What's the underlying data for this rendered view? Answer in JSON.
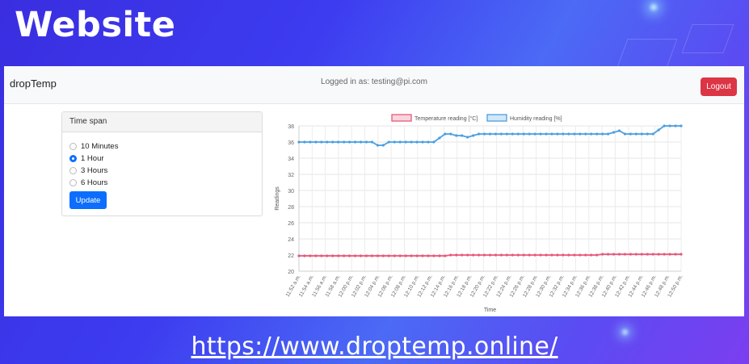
{
  "slide": {
    "title": "Website",
    "url": "https://www.droptemp.online/"
  },
  "navbar": {
    "brand": "dropTemp",
    "logged_in": "Logged in as: testing@pi.com",
    "logout_label": "Logout"
  },
  "time_span": {
    "header": "Time span",
    "options": [
      "10 Minutes",
      "1 Hour",
      "3 Hours",
      "6 Hours"
    ],
    "selected": "1 Hour",
    "update_label": "Update"
  },
  "colors": {
    "temperature": "#e8577b",
    "humidity": "#4a9fe0",
    "logout": "#dc3545",
    "primary": "#0d6efd"
  },
  "chart_data": {
    "type": "line",
    "xlabel": "Time",
    "ylabel": "Readings",
    "ylim": [
      20,
      38
    ],
    "yticks": [
      20,
      22,
      24,
      26,
      28,
      30,
      32,
      34,
      36,
      38
    ],
    "x_tick_labels": [
      "11:52 a.m.",
      "11:54 a.m.",
      "11:56 a.m.",
      "11:58 a.m.",
      "12:00 p.m.",
      "12:02 p.m.",
      "12:04 p.m.",
      "12:06 p.m.",
      "12:08 p.m.",
      "12:10 p.m.",
      "12:12 p.m.",
      "12:14 p.m.",
      "12:16 p.m.",
      "12:18 p.m.",
      "12:20 p.m.",
      "12:22 p.m.",
      "12:24 p.m.",
      "12:26 p.m.",
      "12:28 p.m.",
      "12:30 p.m.",
      "12:32 p.m.",
      "12:34 p.m.",
      "12:36 p.m.",
      "12:38 p.m.",
      "12:40 p.m.",
      "12:42 p.m.",
      "12:44 p.m.",
      "12:46 p.m.",
      "12:48 p.m.",
      "12:50 p.m."
    ],
    "grid": true,
    "legend_position": "top",
    "series": [
      {
        "name": "Temperature reading [°C]",
        "values": [
          21.9,
          21.9,
          21.9,
          21.9,
          21.9,
          21.9,
          21.9,
          21.9,
          21.9,
          21.9,
          21.9,
          21.9,
          21.9,
          21.9,
          21.9,
          21.9,
          21.9,
          21.9,
          21.9,
          21.9,
          21.9,
          21.9,
          21.9,
          21.9,
          21.9,
          21.9,
          21.9,
          22.0,
          22.0,
          22.0,
          22.0,
          22.0,
          22.0,
          22.0,
          22.0,
          22.0,
          22.0,
          22.0,
          22.0,
          22.0,
          22.0,
          22.0,
          22.0,
          22.0,
          22.0,
          22.0,
          22.0,
          22.0,
          22.0,
          22.0,
          22.0,
          22.0,
          22.0,
          22.0,
          22.1,
          22.1,
          22.1,
          22.1,
          22.1,
          22.1,
          22.1,
          22.1,
          22.1,
          22.1,
          22.1,
          22.1,
          22.1,
          22.1,
          22.1
        ]
      },
      {
        "name": "Humidity reading [%]",
        "values": [
          36,
          36,
          36,
          36,
          36,
          36,
          36,
          36,
          36,
          36,
          36,
          36,
          36,
          36,
          35.6,
          35.6,
          36,
          36,
          36,
          36,
          36,
          36,
          36,
          36,
          36,
          36.5,
          37,
          37,
          36.8,
          36.8,
          36.6,
          36.8,
          37,
          37,
          37,
          37,
          37,
          37,
          37,
          37,
          37,
          37,
          37,
          37,
          37,
          37,
          37,
          37,
          37,
          37,
          37,
          37,
          37,
          37,
          37,
          37,
          37.2,
          37.4,
          37,
          37,
          37,
          37,
          37,
          37,
          37.5,
          38,
          38,
          38,
          38
        ]
      }
    ]
  }
}
